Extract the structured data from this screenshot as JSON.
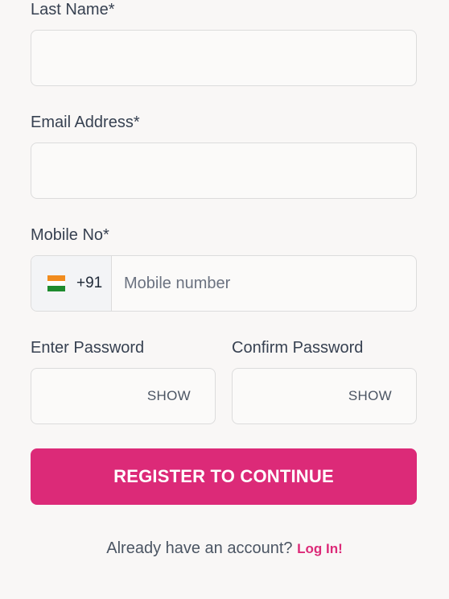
{
  "form": {
    "last_name": {
      "label": "Last Name*",
      "value": ""
    },
    "email": {
      "label": "Email Address*",
      "value": ""
    },
    "mobile": {
      "label": "Mobile No*",
      "country_code": "+91",
      "flag": "india-flag-icon",
      "placeholder": "Mobile number",
      "value": ""
    },
    "password": {
      "label": "Enter Password",
      "toggle": "SHOW",
      "value": ""
    },
    "confirm_password": {
      "label": "Confirm Password",
      "toggle": "SHOW",
      "value": ""
    },
    "register_button": "REGISTER TO CONTINUE"
  },
  "footer": {
    "text": "Already have an account?",
    "login_link": "Log In!"
  },
  "colors": {
    "accent": "#dc2a78",
    "background": "#f9f7f6",
    "border": "#dcdcdc"
  }
}
